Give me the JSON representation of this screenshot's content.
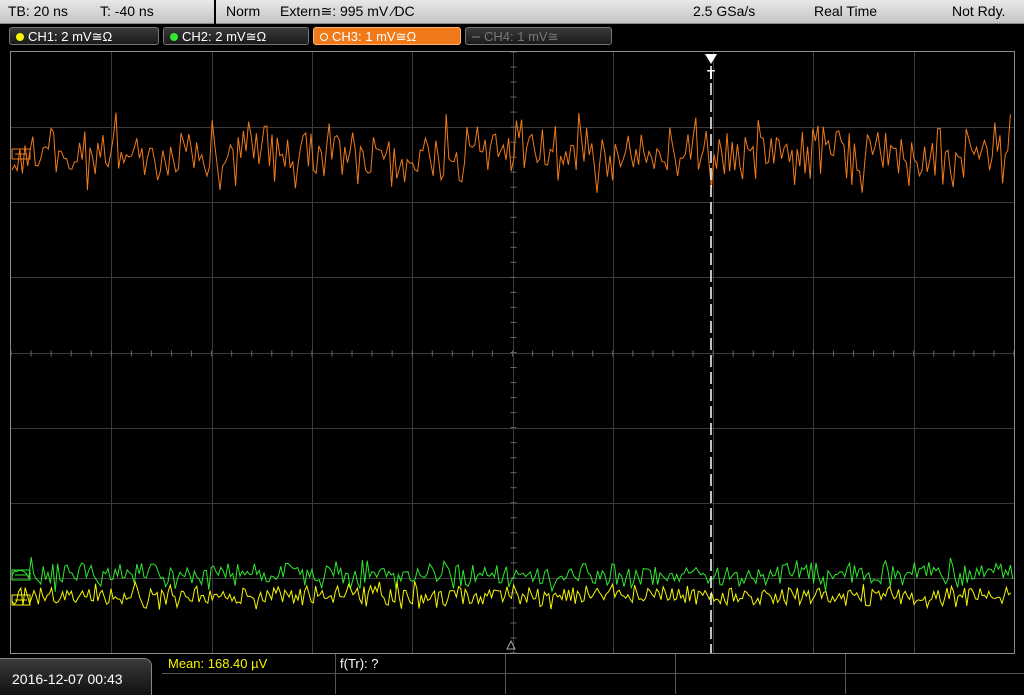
{
  "status_bar": {
    "timebase": "TB: 20 ns",
    "trigger_time": "T: -40 ns",
    "mode": "Norm",
    "trigger_source": "Extern≅: 995 mV ⁄DC",
    "sample_rate": "2.5 GSa/s",
    "acquisition": "Real Time",
    "state": "Not Rdy."
  },
  "channels": [
    {
      "label": "CH1: 2 mV≅Ω",
      "color": "#f5f500",
      "active": false,
      "enabled": true
    },
    {
      "label": "CH2: 2 mV≅Ω",
      "color": "#30e830",
      "active": false,
      "enabled": true
    },
    {
      "label": "CH3: 1 mV≅Ω",
      "color": "#f07a1a",
      "active": true,
      "enabled": true
    },
    {
      "label": "CH4: 1 mV≅",
      "color": "#777777",
      "active": false,
      "enabled": false
    }
  ],
  "trace_colors": {
    "ch1": "#f5f500",
    "ch2": "#2fe82f",
    "ch3": "#f07a1a"
  },
  "trigger_marker_label": "T",
  "datetime": "2016-12-07 00:43",
  "measurements": {
    "mean": "Mean: 168.40 µV",
    "freq": "f(Tr): ?"
  }
}
